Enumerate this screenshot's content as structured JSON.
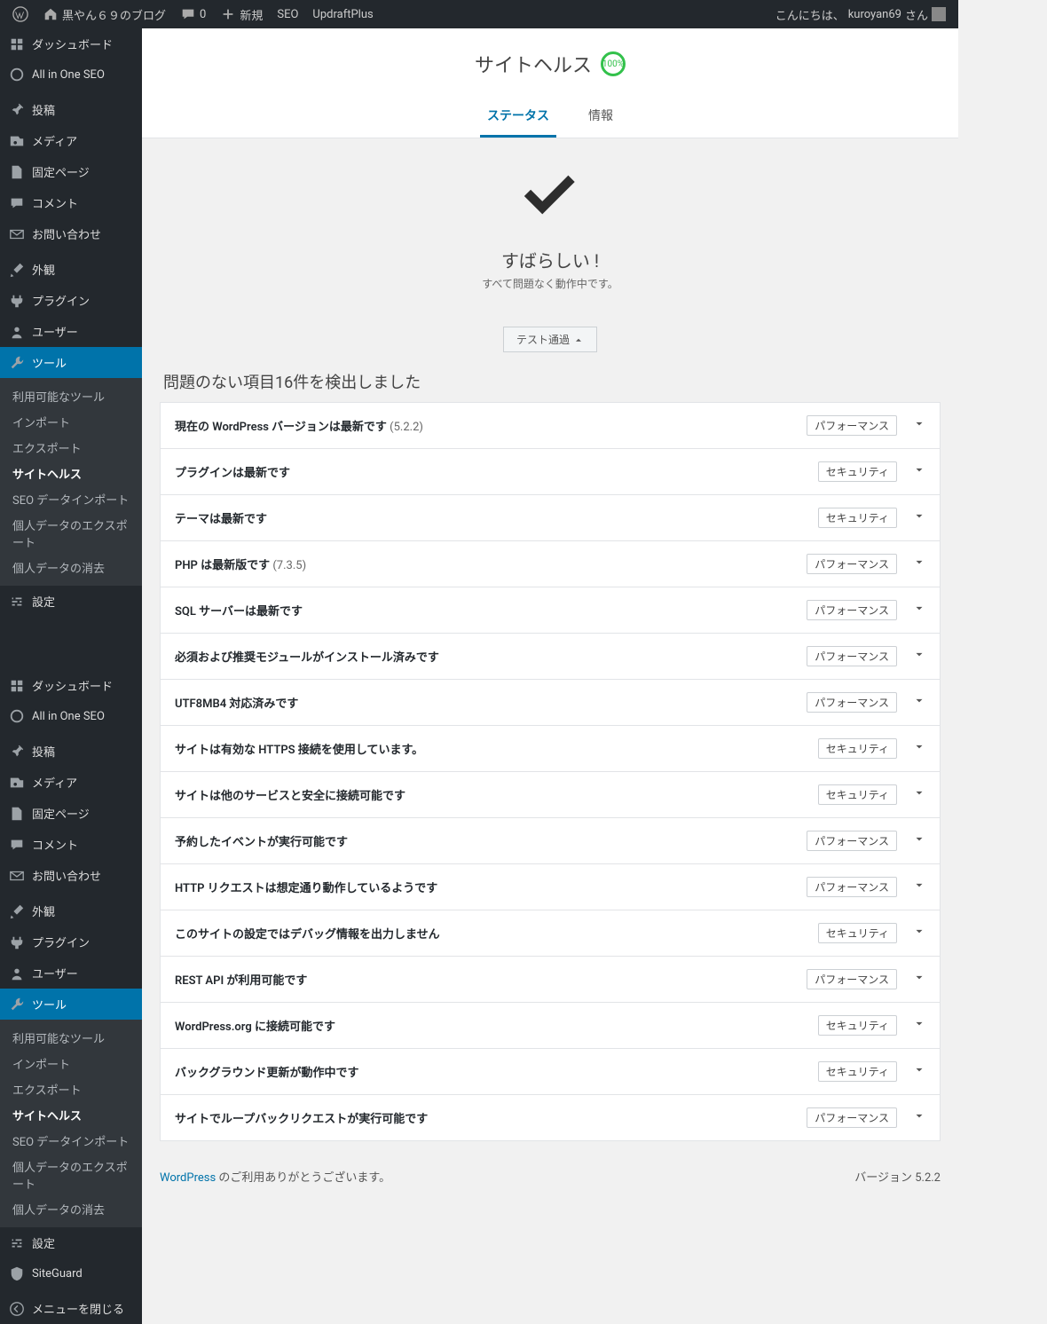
{
  "adminbar": {
    "site_name": "黒やん６９のブログ",
    "comments": "0",
    "add_new": "新規",
    "seo": "SEO",
    "updraft": "UpdraftPlus",
    "greeting_prefix": "こんにちは、",
    "username": "kuroyan69",
    "greeting_suffix": " さん"
  },
  "menu": {
    "dashboard": "ダッシュボード",
    "aioseo": "All in One SEO",
    "posts": "投稿",
    "media": "メディア",
    "pages": "固定ページ",
    "comments": "コメント",
    "contact": "お問い合わせ",
    "appearance": "外観",
    "plugins": "プラグイン",
    "users": "ユーザー",
    "tools": "ツール",
    "settings": "設定",
    "siteguard": "SiteGuard",
    "collapse": "メニューを閉じる",
    "tools_sub": {
      "available": "利用可能なツール",
      "import": "インポート",
      "export": "エクスポート",
      "site_health": "サイトヘルス",
      "seo_import": "SEO データインポート",
      "export_personal": "個人データのエクスポート",
      "erase_personal": "個人データの消去"
    }
  },
  "health": {
    "title": "サイトヘルス",
    "score": "100%",
    "tab_status": "ステータス",
    "tab_info": "情報",
    "ok_title": "すばらしい !",
    "ok_subtitle": "すべて問題なく動作中です。",
    "toggle_label": "テスト通過",
    "issues_heading": "問題のない項目16件を検出しました",
    "badge_perf": "パフォーマンス",
    "badge_sec": "セキュリティ",
    "items": [
      {
        "title_a": "現在の WordPress バージョンは最新です",
        "title_b": "(5.2.2)",
        "badge": "perf"
      },
      {
        "title_a": "プラグインは最新です",
        "title_b": "",
        "badge": "sec"
      },
      {
        "title_a": "テーマは最新です",
        "title_b": "",
        "badge": "sec"
      },
      {
        "title_a": "PHP は最新版です",
        "title_b": "(7.3.5)",
        "badge": "perf"
      },
      {
        "title_a": "SQL サーバーは最新です",
        "title_b": "",
        "badge": "perf"
      },
      {
        "title_a": "必須および推奨モジュールがインストール済みです",
        "title_b": "",
        "badge": "perf"
      },
      {
        "title_a": "UTF8MB4 対応済みです",
        "title_b": "",
        "badge": "perf"
      },
      {
        "title_a": "サイトは有効な HTTPS 接続を使用しています。",
        "title_b": "",
        "badge": "sec"
      },
      {
        "title_a": "サイトは他のサービスと安全に接続可能です",
        "title_b": "",
        "badge": "sec"
      },
      {
        "title_a": "予約したイベントが実行可能です",
        "title_b": "",
        "badge": "perf"
      },
      {
        "title_a": "HTTP リクエストは想定通り動作しているようです",
        "title_b": "",
        "badge": "perf"
      },
      {
        "title_a": "このサイトの設定ではデバッグ情報を出力しません",
        "title_b": "",
        "badge": "sec"
      },
      {
        "title_a": "REST API が利用可能です",
        "title_b": "",
        "badge": "perf"
      },
      {
        "title_a": "WordPress.org に接続可能です",
        "title_b": "",
        "badge": "sec"
      },
      {
        "title_a": "バックグラウンド更新が動作中です",
        "title_b": "",
        "badge": "sec"
      },
      {
        "title_a": "サイトでループバックリクエストが実行可能です",
        "title_b": "",
        "badge": "perf"
      }
    ]
  },
  "footer": {
    "link": "WordPress",
    "thanks": " のご利用ありがとうございます。",
    "version": "バージョン 5.2.2"
  }
}
